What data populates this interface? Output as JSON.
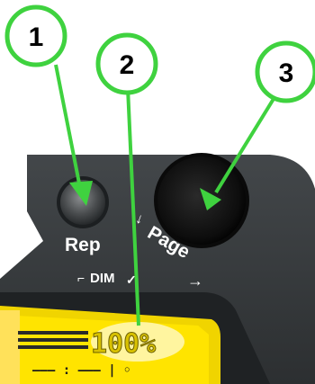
{
  "callouts": [
    {
      "number": "1",
      "target": "rep-button"
    },
    {
      "number": "2",
      "target": "lcd-dim-readout"
    },
    {
      "number": "3",
      "target": "page-knob"
    }
  ],
  "panel": {
    "rep_label": "Rep",
    "dim_label": "DIM",
    "page_label": "Page",
    "page_arrow_left": "←",
    "page_arrow_right": "→"
  },
  "lcd": {
    "brightness_readout": "100%",
    "bottom_row": "––– : ––– | ◦"
  },
  "colors": {
    "callout_fill": "#ffffff",
    "callout_stroke": "#3fd23f",
    "panel": "#3a3e41",
    "panel_dark": "#232628",
    "knob": "#121212",
    "lcd_yellow": "#ffe400",
    "lcd_text": "#1a1a1a"
  }
}
